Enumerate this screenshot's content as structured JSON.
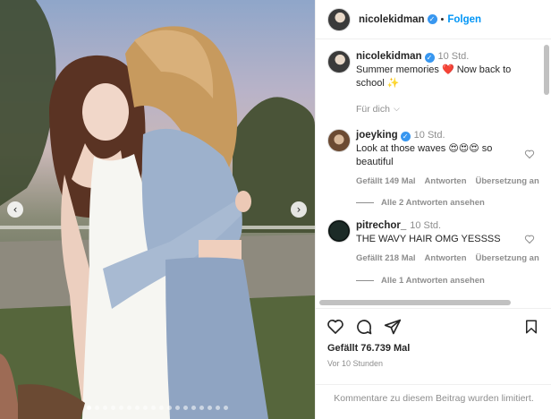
{
  "post": {
    "author": "nicolekidman",
    "follow_sep": "•",
    "follow_label": "Folgen",
    "caption_time": "10 Std.",
    "caption_text": "Summer memories ❤️ Now back to school ✨",
    "translate_label": "Für dich"
  },
  "comments": [
    {
      "user": "joeyking",
      "time": "10 Std.",
      "text": "Look at those waves 😍😍😍 so beautiful",
      "likes": "Gefällt 149 Mal",
      "reply": "Antworten",
      "translate": "Übersetzung an",
      "replies": "Alle 2 Antworten ansehen"
    },
    {
      "user": "pitrechor_",
      "time": "10 Std.",
      "text": "THE WAVY HAIR OMG YESSSS",
      "likes": "Gefällt 218 Mal",
      "reply": "Antworten",
      "translate": "Übersetzung an",
      "replies": "Alle 1 Antworten ansehen"
    }
  ],
  "footer": {
    "likes": "Gefällt 76.739 Mal",
    "ago": "Vor 10 Stunden",
    "limited": "Kommentare zu diesem Beitrag wurden limitiert."
  },
  "carousel": {
    "total_slides": 18,
    "active_slide": 1
  },
  "icons": [
    "heart-icon",
    "comment-icon",
    "share-icon",
    "bookmark-icon",
    "verified-icon",
    "chevron-left-icon",
    "chevron-right-icon"
  ],
  "colors": {
    "accent": "#0095f6",
    "verified": "#3897f0",
    "muted": "#8e8e8e"
  }
}
